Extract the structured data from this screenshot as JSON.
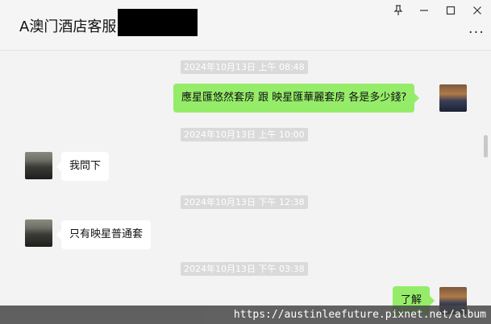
{
  "header": {
    "title": "A澳门酒店客服",
    "pin_icon": "pin-icon",
    "minimize_icon": "minimize-icon",
    "maximize_icon": "maximize-icon",
    "close_icon": "close-icon",
    "more_label": "···"
  },
  "messages": [
    {
      "type": "timestamp",
      "text": "2024年10月13日 上午 08:48"
    },
    {
      "type": "bubble",
      "side": "me",
      "text": "應星匯悠然套房 跟 映星匯華麗套房 各是多少錢?"
    },
    {
      "type": "timestamp",
      "text": "2024年10月13日 上午 10:00"
    },
    {
      "type": "bubble",
      "side": "other",
      "text": "我問下"
    },
    {
      "type": "timestamp",
      "text": "2024年10月13日 下午 12:38"
    },
    {
      "type": "bubble",
      "side": "other",
      "text": "只有映星普通套"
    },
    {
      "type": "timestamp",
      "text": "2024年10月13日 下午 03:38"
    },
    {
      "type": "bubble",
      "side": "me",
      "text": "了解"
    }
  ],
  "watermark": "https://austinleefuture.pixnet.net/album",
  "colors": {
    "my_bubble": "#95ec69",
    "other_bubble": "#ffffff",
    "background": "#f3f3f3"
  }
}
